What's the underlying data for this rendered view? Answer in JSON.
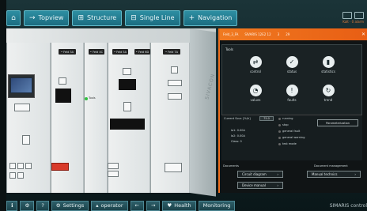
{
  "topbar": {
    "home_icon": "home-icon",
    "buttons": [
      {
        "label": "Topview",
        "icon": "arrow-icon"
      },
      {
        "label": "Structure",
        "icon": "structure-icon"
      },
      {
        "label": "Single Line",
        "icon": "single-line-icon"
      },
      {
        "label": "Navigation",
        "icon": "plus-icon"
      }
    ],
    "status_text": "Kalt · 0 alarm"
  },
  "cabinet": {
    "brand": "SIVACON",
    "labels": [
      "Tools"
    ],
    "strip_labels": [
      "• Feld 3A",
      "• Feld 4C",
      "• Feld 5A",
      "• Feld 6D",
      "• Feld 7A"
    ]
  },
  "side_panel": {
    "header": {
      "title": "Feld_3_FA",
      "center": "SIVARIS 12E2 12",
      "page": "3",
      "count": "29",
      "close": "✕"
    },
    "tools": {
      "title": "Tools",
      "items": [
        {
          "label": "control",
          "icon": "control-icon"
        },
        {
          "label": "status",
          "icon": "check-icon"
        },
        {
          "label": "statistics",
          "icon": "statistics-icon"
        },
        {
          "label": "values",
          "icon": "gauge-icon"
        },
        {
          "label": "faults",
          "icon": "exclamation-icon"
        },
        {
          "label": "trend",
          "icon": "trend-icon"
        }
      ]
    },
    "measurement": {
      "label": "Current Sour. [%/h]",
      "input_value": "75.0",
      "lines": [
        "Ia1: 0.00A",
        "Ia2: 0.00A",
        "Class: 0"
      ],
      "statuses": [
        "running",
        "stop",
        "general fault",
        "general warning",
        "test mode"
      ],
      "param_button": "Parameterization"
    },
    "documents": {
      "title": "Documents",
      "right_title": "Document management",
      "buttons": [
        "Circuit diagram",
        "Device manual",
        "Manual technics"
      ]
    }
  },
  "bottombar": {
    "buttons": [
      {
        "label": "",
        "icon": "info-icon"
      },
      {
        "label": "",
        "icon": "help-icon"
      },
      {
        "label": "",
        "icon": "question-icon"
      },
      {
        "label": "Settings",
        "icon": "settings-icon"
      },
      {
        "label": "operator",
        "icon": "user-icon"
      },
      {
        "label": "",
        "icon": "arrow-left-icon"
      },
      {
        "label": "",
        "icon": "arrow-right-icon"
      },
      {
        "label": "Health",
        "icon": "health-icon"
      },
      {
        "label": "Monitoring",
        "icon": ""
      }
    ],
    "brand": "SIMARIS control"
  }
}
